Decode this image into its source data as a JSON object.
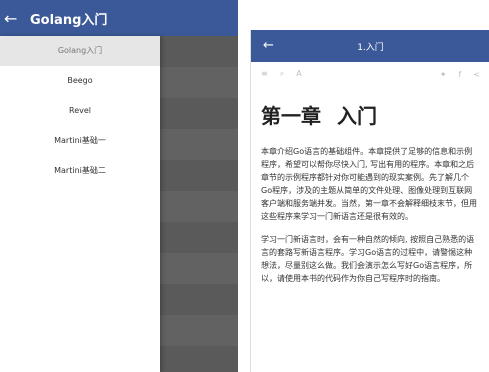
{
  "left": {
    "back_icon": "arrow-left-icon",
    "title": "Golang入门",
    "menu": [
      {
        "label": "Golang入门",
        "active": true
      },
      {
        "label": "Beego",
        "active": false
      },
      {
        "label": "Revel",
        "active": false
      },
      {
        "label": "Martini基础一",
        "active": false
      },
      {
        "label": "Martini基础二",
        "active": false
      }
    ]
  },
  "right": {
    "back_icon": "arrow-left-icon",
    "title": "1.入门",
    "toolbar": {
      "menu_icon": "≡",
      "search_icon": "⌕",
      "font_icon": "A",
      "twitter_icon": "✦",
      "facebook_icon": "f",
      "share_icon": "<"
    },
    "chapter": {
      "num": "第一章",
      "name": "入门"
    },
    "paragraphs": [
      "本章介绍Go语言的基础组件。本章提供了足够的信息和示例程序，希望可以帮你尽快入门, 写出有用的程序。本章和之后章节的示例程序都针对你可能遇到的现实案例。先了解几个Go程序，涉及的主题从简单的文件处理、图像处理到互联网客户端和服务端并发。当然，第一章不会解释细枝末节，但用这些程序来学习一门新语言还是很有效的。",
      "学习一门新语言时，会有一种自然的倾向, 按照自己熟悉的语言的套路写新语言程序。学习Go语言的过程中，请警惕这种想法，尽量别这么做。我们会演示怎么写好Go语言程序，所以，请使用本书的代码作为你自己写程序时的指南。"
    ]
  },
  "colors": {
    "appbar": "#3b5998",
    "overlay": "#666666",
    "drawer_active": "#e6e6e6"
  }
}
